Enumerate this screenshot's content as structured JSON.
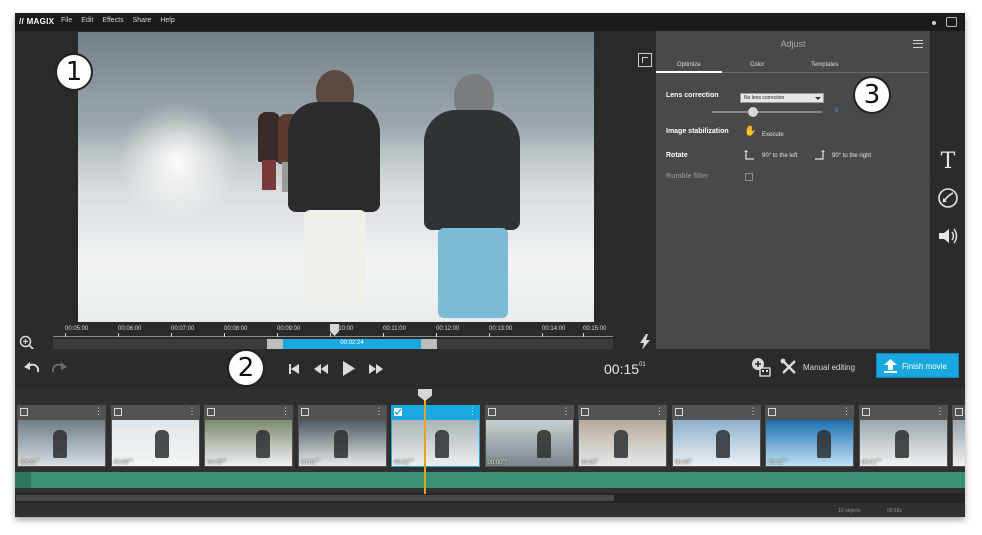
{
  "app": {
    "logo": "// MAGIX",
    "menu": [
      "File",
      "Edit",
      "Effects",
      "Share",
      "Help"
    ]
  },
  "badges": {
    "one": "1",
    "two": "2",
    "three": "3"
  },
  "ruler": {
    "labels": [
      "00:05:00",
      "00:06:00",
      "00:07:00",
      "00:08:00",
      "00:09:00",
      "00:10:00",
      "00:11:00",
      "00:12:00",
      "00:13:00",
      "00:14:00",
      "00:15:00"
    ],
    "range_time": "00:02:24"
  },
  "adjust": {
    "title": "Adjust",
    "tabs": [
      "Optimize",
      "Color",
      "Templates"
    ],
    "active_tab": "Optimize",
    "lens_correction": {
      "label": "Lens correction",
      "value": "No lens correction",
      "slider_value": "0"
    },
    "image_stabilization": {
      "label": "Image stabilization",
      "action": "Execute"
    },
    "rotate": {
      "label": "Rotate",
      "left": "90° to the left",
      "right": "90° to the right"
    },
    "rumble_filter": {
      "label": "Rumble filter",
      "checked": false
    }
  },
  "side_panel": {
    "icons": [
      "title-icon",
      "adjust-icon",
      "audio-icon"
    ],
    "active": "adjust-icon"
  },
  "transport": {
    "timecode": "00:15",
    "timecode_frames": "01",
    "manual_editing": "Manual editing",
    "finish_movie": "Finish movie"
  },
  "clips": [
    {
      "duration": "00:03",
      "frames": "24",
      "selected": false,
      "checked": false,
      "colors": [
        "#6f7d86",
        "#d9dfe3"
      ]
    },
    {
      "duration": "00:05",
      "frames": "24",
      "selected": false,
      "checked": false,
      "colors": [
        "#dfe6ea",
        "#f4f6f7"
      ]
    },
    {
      "duration": "00:03",
      "frames": "24",
      "selected": false,
      "checked": false,
      "colors": [
        "#7e8b6e",
        "#eef1f2"
      ]
    },
    {
      "duration": "00:01",
      "frames": "50",
      "selected": false,
      "checked": false,
      "colors": [
        "#4f5a60",
        "#e6eaec"
      ]
    },
    {
      "duration": "00:02",
      "frames": "24",
      "selected": true,
      "checked": true,
      "colors": [
        "#aab4b8",
        "#eceff0"
      ]
    },
    {
      "duration": "00:00",
      "frames": "63",
      "selected": false,
      "checked": false,
      "colors": [
        "#c8cfd3",
        "#7c868b"
      ]
    },
    {
      "duration": "00:00",
      "frames": "4",
      "selected": false,
      "checked": false,
      "colors": [
        "#b5a99a",
        "#e8eaeb"
      ]
    },
    {
      "duration": "00:00",
      "frames": "8",
      "selected": false,
      "checked": false,
      "colors": [
        "#8fb0cc",
        "#eef2f5"
      ]
    },
    {
      "duration": "00:01",
      "frames": "82",
      "selected": false,
      "checked": false,
      "colors": [
        "#1f6fb0",
        "#bfe2f5"
      ]
    },
    {
      "duration": "00:01",
      "frames": "53",
      "selected": false,
      "checked": false,
      "colors": [
        "#9ca7ad",
        "#f1f3f4"
      ]
    },
    {
      "duration": "",
      "frames": "",
      "selected": false,
      "checked": false,
      "colors": [
        "#9aa5ab",
        "#eef0f1"
      ]
    }
  ],
  "status": {
    "objects": "10 objects",
    "duration": "00:18s"
  }
}
